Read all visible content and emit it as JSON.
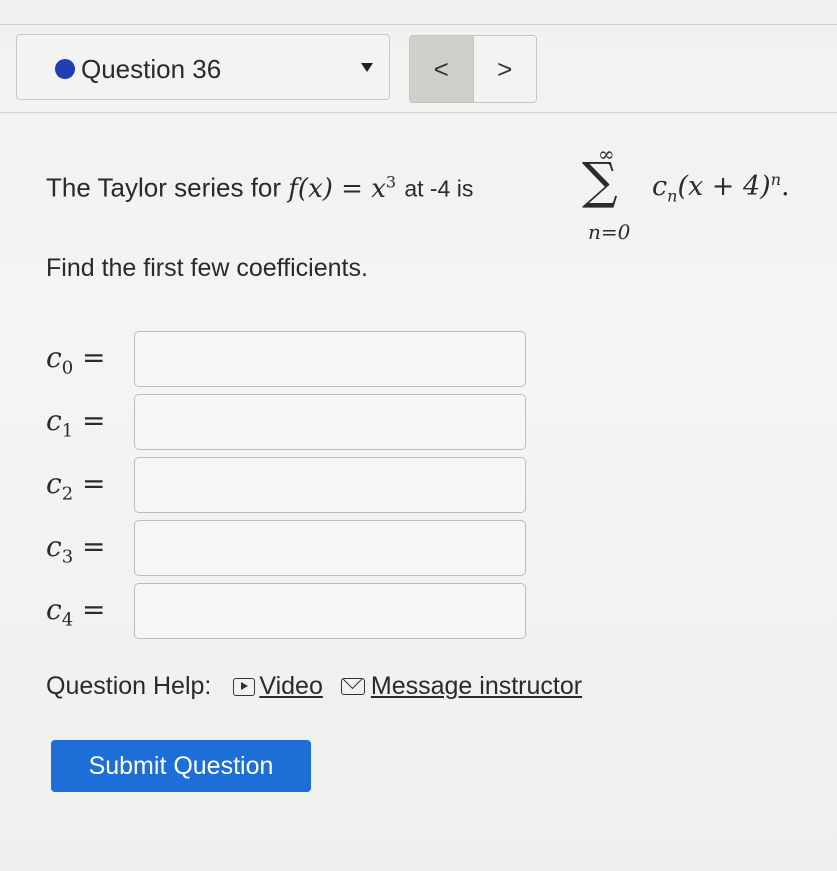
{
  "header": {
    "question_label": "Question 36",
    "prev_label": "<",
    "next_label": ">"
  },
  "problem": {
    "prefix": "The Taylor series for",
    "function_lhs": "f(x)",
    "equals": "=",
    "function_rhs_base": "x",
    "function_rhs_exp": "3",
    "at_text": "at -4 is",
    "sum_upper": "∞",
    "sum_symbol": "∑",
    "sum_lower": "n=0",
    "term_coef": "c",
    "term_coef_sub": "n",
    "term_paren": "(x + 4)",
    "term_exp": "n",
    "term_end": "."
  },
  "instruction": "Find the first few coefficients.",
  "coefficients": [
    {
      "name": "c",
      "sub": "0",
      "eq": "=",
      "value": ""
    },
    {
      "name": "c",
      "sub": "1",
      "eq": "=",
      "value": ""
    },
    {
      "name": "c",
      "sub": "2",
      "eq": "=",
      "value": ""
    },
    {
      "name": "c",
      "sub": "3",
      "eq": "=",
      "value": ""
    },
    {
      "name": "c",
      "sub": "4",
      "eq": "=",
      "value": ""
    }
  ],
  "help": {
    "label": "Question Help:",
    "video_label": "Video",
    "message_label": "Message instructor"
  },
  "submit_label": "Submit Question",
  "colors": {
    "accent_blue": "#1d6ed6",
    "dot_blue": "#1f3fb3"
  }
}
